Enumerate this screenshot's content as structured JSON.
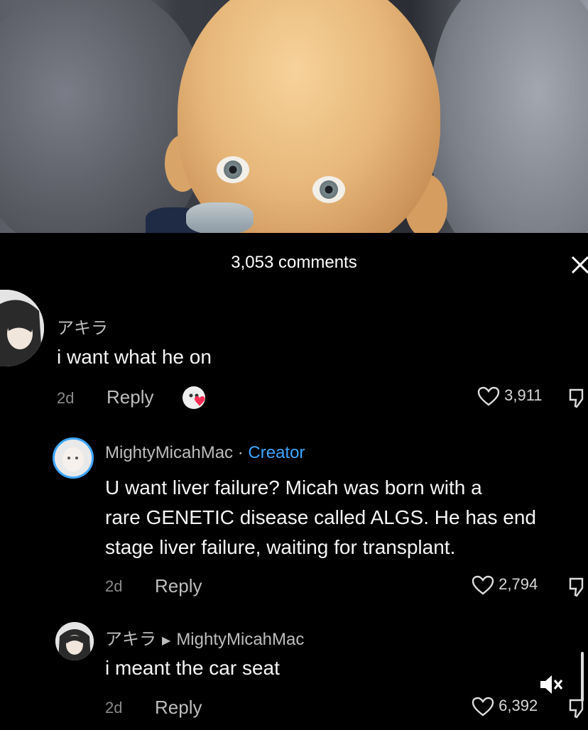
{
  "header": {
    "title": "3,053 comments",
    "close_icon": "close-icon"
  },
  "comments": [
    {
      "username": "アキラ",
      "text": "i want what he on",
      "age": "2d",
      "reply_label": "Reply",
      "likes": "3,911"
    },
    {
      "username": "MightyMicahMac",
      "separator": "·",
      "badge": "Creator",
      "text_lines": [
        "U want liver failure? Micah was born with a",
        "rare GENETIC disease called ALGS. He has end",
        "stage liver failure, waiting for transplant."
      ],
      "age": "2d",
      "reply_label": "Reply",
      "likes": "2,794"
    },
    {
      "username": "アキラ",
      "reply_to": "MightyMicahMac",
      "text": "i meant the car seat",
      "age": "2d",
      "reply_label": "Reply",
      "likes": "6,392"
    }
  ],
  "colors": {
    "background": "#000000",
    "creator_badge": "#3ea6ff",
    "liked_heart": "#ff2d55"
  }
}
